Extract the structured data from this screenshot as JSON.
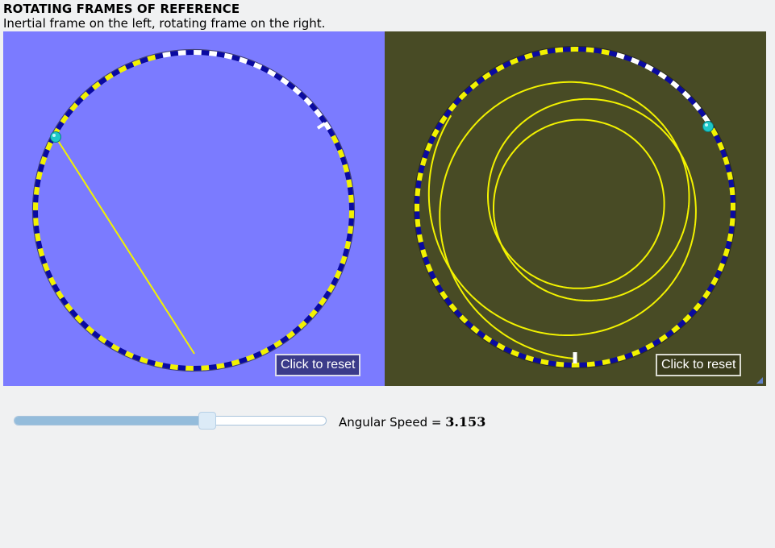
{
  "header": {
    "title": "ROTATING FRAMES OF REFERENCE",
    "subtitle": "Inertial frame on the left, rotating frame on the right."
  },
  "inertial_panel": {
    "background": "#7b7bff",
    "reset_label": "Click to reset"
  },
  "rotating_panel": {
    "background": "#484b25",
    "reset_label": "Click to reset"
  },
  "colors": {
    "ring_dark": "#0a0aa0",
    "ring_light": "#f2f200",
    "ring_white": "#ffffff",
    "path": "#f2f200",
    "puck": "#1ec8c8"
  },
  "speed_control": {
    "label": "Angular Speed = ",
    "value": "3.153",
    "level": 0.62
  }
}
